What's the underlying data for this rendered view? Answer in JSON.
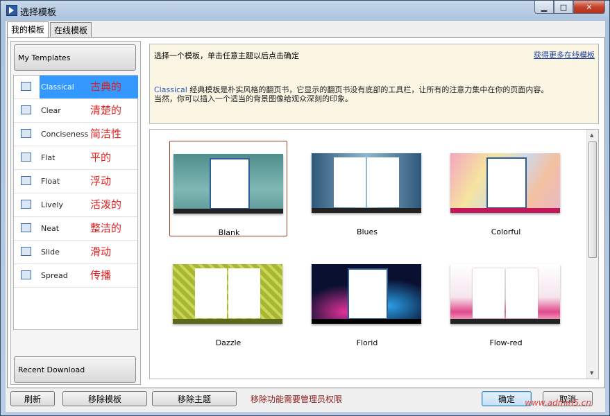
{
  "window": {
    "title": "选择模板"
  },
  "tabs": [
    {
      "label": "我的模板"
    },
    {
      "label": "在线模板"
    }
  ],
  "left": {
    "my_templates": "My Templates",
    "recent_download": "Recent Download",
    "items": [
      {
        "label": "Classical",
        "cn": "古典的"
      },
      {
        "label": "Clear",
        "cn": "清楚的"
      },
      {
        "label": "Conciseness",
        "cn": "简洁性"
      },
      {
        "label": "Flat",
        "cn": "平的"
      },
      {
        "label": "Float",
        "cn": "浮动"
      },
      {
        "label": "Lively",
        "cn": "活泼的"
      },
      {
        "label": "Neat",
        "cn": "整洁的"
      },
      {
        "label": "Slide",
        "cn": "滑动"
      },
      {
        "label": "Spread",
        "cn": "传播"
      }
    ]
  },
  "desc": {
    "instruction": "选择一个模板，单击任意主题以后点击确定",
    "more_link": "获得更多在线模板",
    "body_name": "Classical",
    "body_line1": " 经典模板是朴实风格的翻页书，它显示的翻页书没有底部的工具栏，让所有的注意力集中在你的页面内容。",
    "body_line2": "当然，你可以插入一个适当的背景图像给观众深刻的印象。"
  },
  "themes": [
    {
      "name": "Blank",
      "bg": "#6faaa8"
    },
    {
      "name": "Blues",
      "bg": "#6b93b0"
    },
    {
      "name": "Colorful",
      "bg": "#e9b9c8"
    },
    {
      "name": "Dazzle",
      "bg": "#a8b632"
    },
    {
      "name": "Florid",
      "bg": "#0d1a45"
    },
    {
      "name": "Flow-red",
      "bg": "#e14a8c"
    }
  ],
  "buttons": {
    "refresh": "刷新",
    "remove_template": "移除模板",
    "remove_theme": "移除主题",
    "ok": "确定",
    "cancel": "取消"
  },
  "warning": "移除功能需要管理员权限",
  "watermark": "www.admin5.cn",
  "colors": {
    "selection": "#3399ff",
    "chinese_label": "#e02020",
    "link": "#1a3ea6"
  }
}
